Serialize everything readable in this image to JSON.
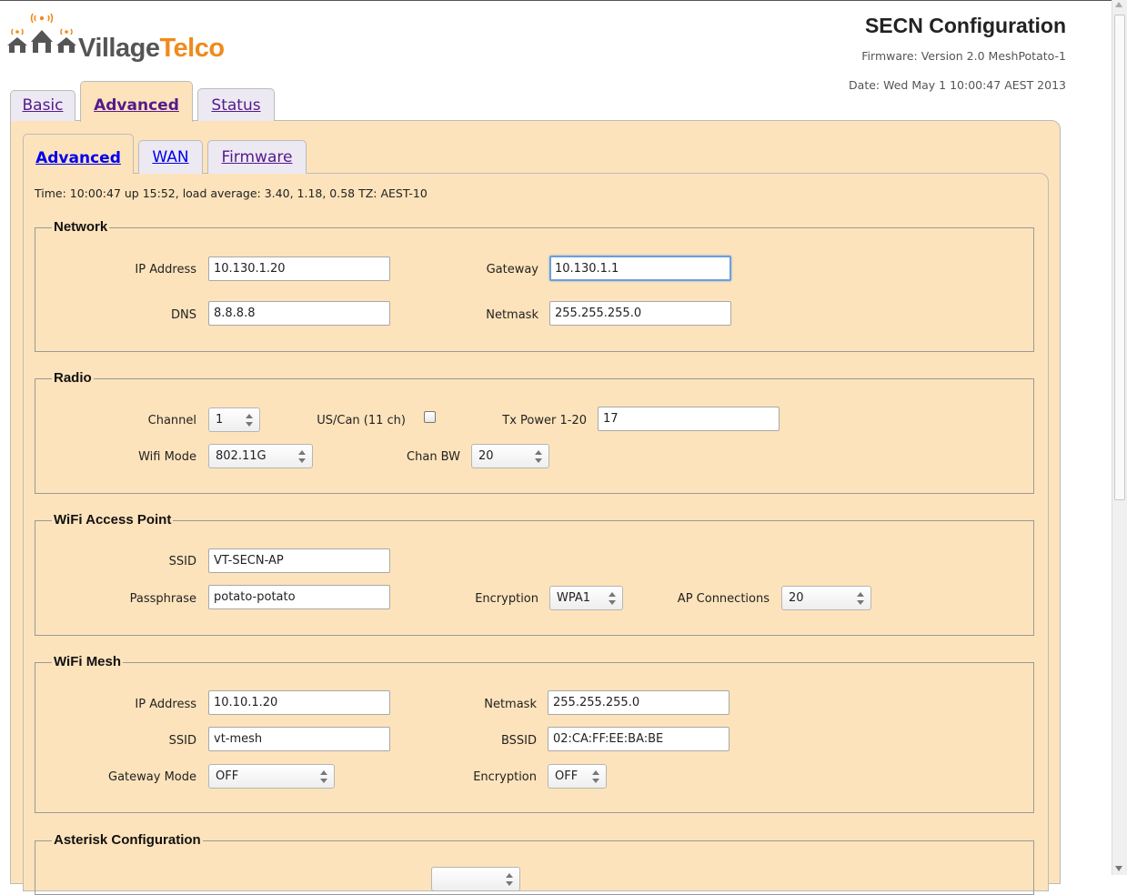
{
  "logo": {
    "village": "Village",
    "telco": "Telco",
    "icon": "village-houses-wifi-icon"
  },
  "header": {
    "title": "SECN Configuration",
    "firmware": "Firmware: Version 2.0 MeshPotato-1",
    "date": "Date: Wed May 1 10:00:47 AEST 2013"
  },
  "tabs": [
    {
      "label": "Basic",
      "active": false
    },
    {
      "label": "Advanced",
      "active": true
    },
    {
      "label": "Status",
      "active": false
    }
  ],
  "subtabs": [
    {
      "label": "Advanced",
      "active": true
    },
    {
      "label": "WAN",
      "active": false
    },
    {
      "label": "Firmware",
      "active": false
    }
  ],
  "status_line": "Time: 10:00:47 up 15:52, load average: 3.40, 1.18, 0.58 TZ: AEST-10",
  "network": {
    "legend": "Network",
    "ip_label": "IP Address",
    "ip_value": "10.130.1.20",
    "gateway_label": "Gateway",
    "gateway_value": "10.130.1.1",
    "dns_label": "DNS",
    "dns_value": "8.8.8.8",
    "netmask_label": "Netmask",
    "netmask_value": "255.255.255.0"
  },
  "radio": {
    "legend": "Radio",
    "channel_label": "Channel",
    "channel_value": "1",
    "uscan_label": "US/Can (11 ch)",
    "uscan_checked": false,
    "txpower_label": "Tx Power 1-20",
    "txpower_value": "17",
    "wifimode_label": "Wifi Mode",
    "wifimode_value": "802.11G",
    "chanbw_label": "Chan BW",
    "chanbw_value": "20"
  },
  "ap": {
    "legend": "WiFi Access Point",
    "ssid_label": "SSID",
    "ssid_value": "VT-SECN-AP",
    "pass_label": "Passphrase",
    "pass_value": "potato-potato",
    "enc_label": "Encryption",
    "enc_value": "WPA1",
    "conn_label": "AP Connections",
    "conn_value": "20"
  },
  "mesh": {
    "legend": "WiFi Mesh",
    "ip_label": "IP Address",
    "ip_value": "10.10.1.20",
    "netmask_label": "Netmask",
    "netmask_value": "255.255.255.0",
    "ssid_label": "SSID",
    "ssid_value": "vt-mesh",
    "bssid_label": "BSSID",
    "bssid_value": "02:CA:FF:EE:BA:BE",
    "gwmode_label": "Gateway Mode",
    "gwmode_value": "OFF",
    "enc_label": "Encryption",
    "enc_value": "OFF"
  },
  "asterisk": {
    "legend": "Asterisk Configuration"
  },
  "colors": {
    "panel": "#fde3bb",
    "brand_orange": "#f08a1c",
    "brand_gray": "#555555",
    "link": "#551a8b"
  }
}
